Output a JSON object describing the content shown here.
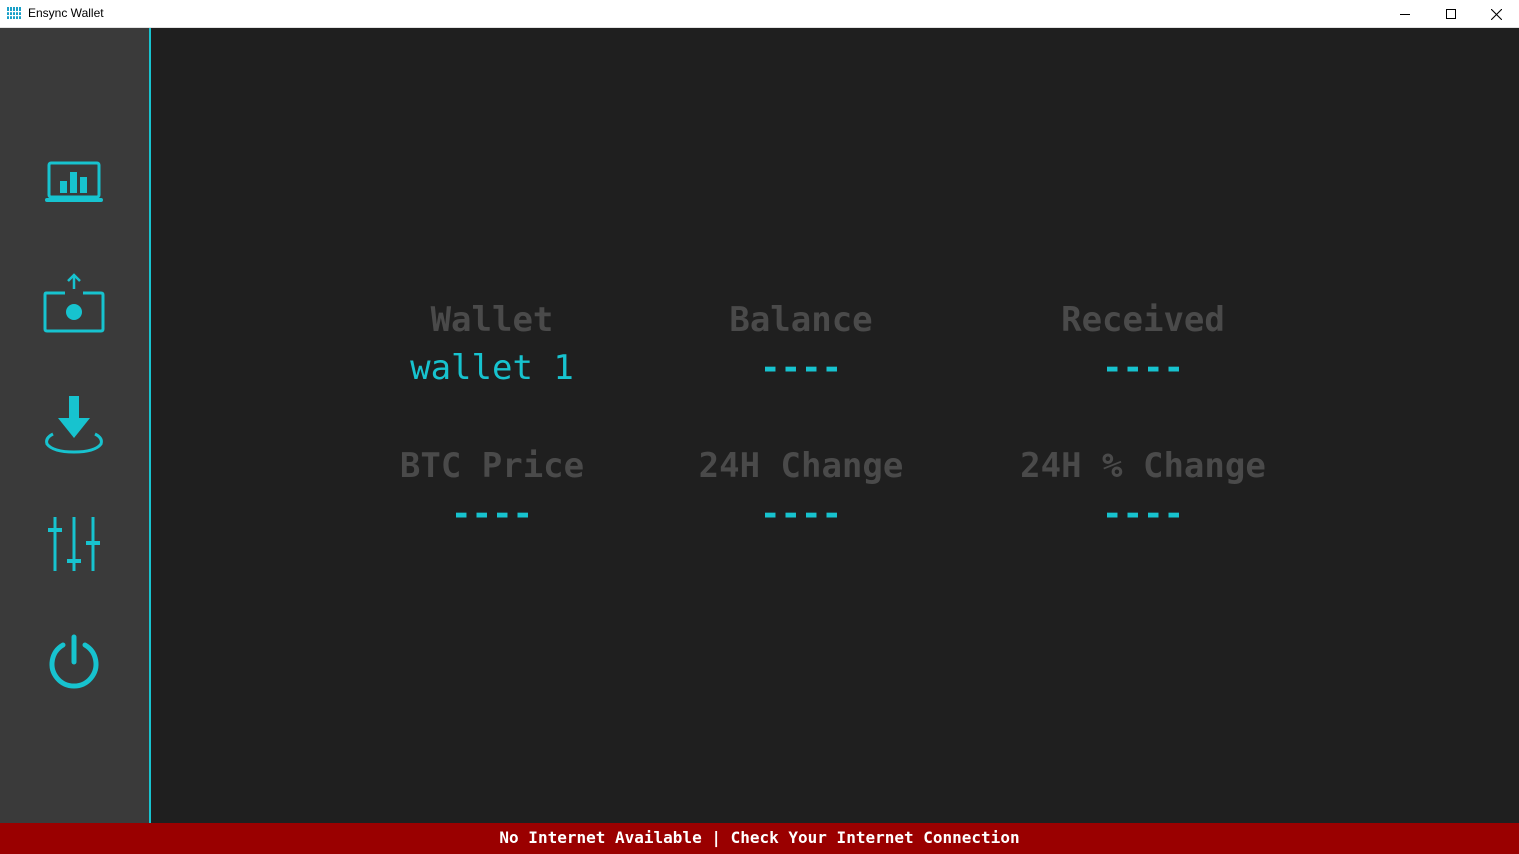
{
  "window": {
    "title": "Ensync Wallet",
    "minimize_icon": "minimize-icon",
    "maximize_icon": "maximize-icon",
    "close_icon": "close-icon"
  },
  "sidebar": {
    "items": [
      {
        "id": "dashboard",
        "icon": "dashboard-chart-icon"
      },
      {
        "id": "send",
        "icon": "send-upload-icon"
      },
      {
        "id": "receive",
        "icon": "receive-download-icon"
      },
      {
        "id": "settings",
        "icon": "settings-sliders-icon"
      },
      {
        "id": "power",
        "icon": "power-icon"
      }
    ]
  },
  "stats": {
    "wallet": {
      "label": "Wallet",
      "value": "wallet 1"
    },
    "balance": {
      "label": "Balance",
      "value": "----"
    },
    "received": {
      "label": "Received",
      "value": "----"
    },
    "btc_price": {
      "label": "BTC Price",
      "value": "----"
    },
    "change_24h": {
      "label": "24H Change",
      "value": "----"
    },
    "change_24h_pct": {
      "label": "24H % Change",
      "value": "----"
    }
  },
  "status": {
    "message": "No Internet Available | Check Your Internet Connection"
  },
  "colors": {
    "accent": "#17c3cf",
    "sidebar_bg": "#3a3a3a",
    "main_bg": "#1f1f1f",
    "label_gray": "#4a4a4a",
    "status_bar": "#9a0000"
  }
}
